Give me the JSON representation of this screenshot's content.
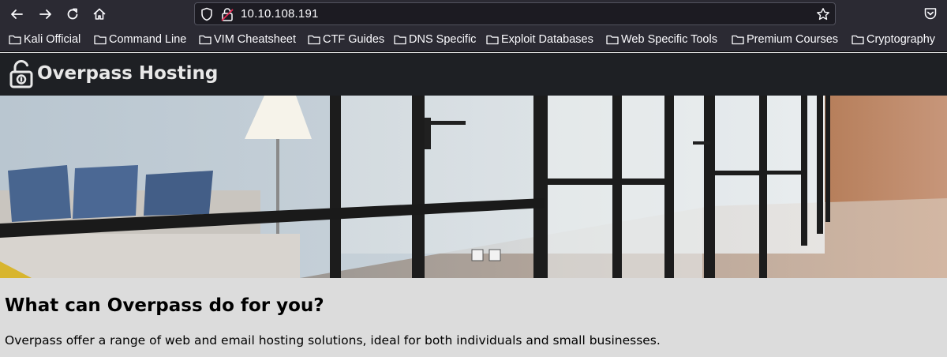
{
  "browser": {
    "url": "10.10.108.191",
    "bookmarks": [
      {
        "label": "Kali Official"
      },
      {
        "label": "Command Line"
      },
      {
        "label": "VIM Cheatsheet"
      },
      {
        "label": "CTF Guides"
      },
      {
        "label": "DNS Specific"
      },
      {
        "label": "Exploit Databases"
      },
      {
        "label": "Web Specific Tools"
      },
      {
        "label": "Premium Courses"
      },
      {
        "label": "Cryptography"
      }
    ]
  },
  "site": {
    "title": "Overpass Hosting",
    "heading": "What can Overpass do for you?",
    "intro": "Overpass offer a range of web and email hosting solutions, ideal for both individuals and small businesses."
  },
  "colors": {
    "toolbar": "#2b2a33",
    "urlbar": "#1c1b22",
    "site_header": "#1e2024",
    "page_background": "#dcdcdc"
  }
}
